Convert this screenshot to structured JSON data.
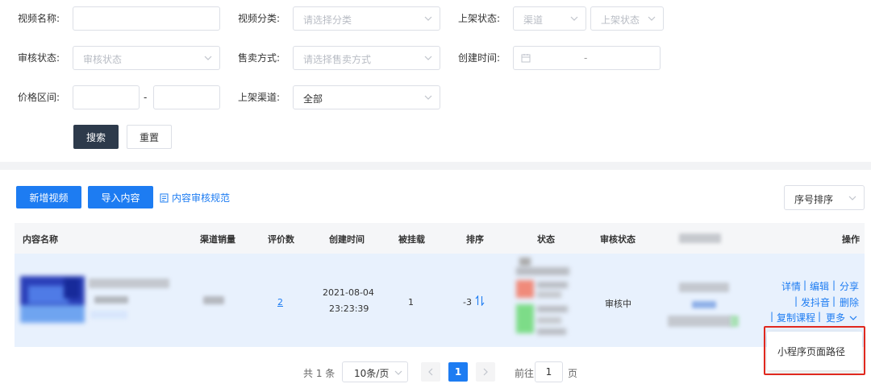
{
  "filters": {
    "video_name_label": "视频名称:",
    "video_category_label": "视频分类:",
    "video_category_placeholder": "请选择分类",
    "listing_status_label": "上架状态:",
    "channel_placeholder": "渠道",
    "listing_status_placeholder": "上架状态",
    "review_status_label": "审核状态:",
    "review_status_placeholder": "审核状态",
    "sale_method_label": "售卖方式:",
    "sale_method_placeholder": "请选择售卖方式",
    "created_time_label": "创建时间:",
    "date_separator": "-",
    "price_range_label": "价格区间:",
    "price_separator": "-",
    "listing_channel_label": "上架渠道:",
    "listing_channel_value": "全部",
    "search_button": "搜索",
    "reset_button": "重置"
  },
  "toolbar": {
    "add_video": "新增视频",
    "import_content": "导入内容",
    "review_guidelines": "内容审核规范",
    "sort_select": "序号排序"
  },
  "table": {
    "headers": {
      "content_name": "内容名称",
      "channel_sales": "渠道销量",
      "rating_count": "评价数",
      "created_time": "创建时间",
      "mounted": "被挂载",
      "sort": "排序",
      "status": "状态",
      "review_status": "审核状态",
      "actions": "操作"
    },
    "row": {
      "rating_count": "2",
      "created_date": "2021-08-04",
      "created_clock": "23:23:39",
      "mounted": "1",
      "sort": "-3",
      "review_status": "审核中"
    },
    "actions": {
      "detail": "详情",
      "edit": "编辑",
      "share": "分享",
      "douyin": "发抖音",
      "delete": "删除",
      "copy_course": "复制课程",
      "more": "更多",
      "separator": "|"
    }
  },
  "dropdown": {
    "mini_program_path": "小程序页面路径"
  },
  "pagination": {
    "total": "共 1 条",
    "page_size": "10条/页",
    "current_page": "1",
    "goto_prefix": "前往",
    "goto_value": "1",
    "goto_suffix": "页"
  },
  "colors": {
    "primary": "#1d7cf2",
    "dark_button": "#2d3a4b",
    "highlight_box": "#e0281e",
    "row_highlight": "#e8f1fd"
  }
}
